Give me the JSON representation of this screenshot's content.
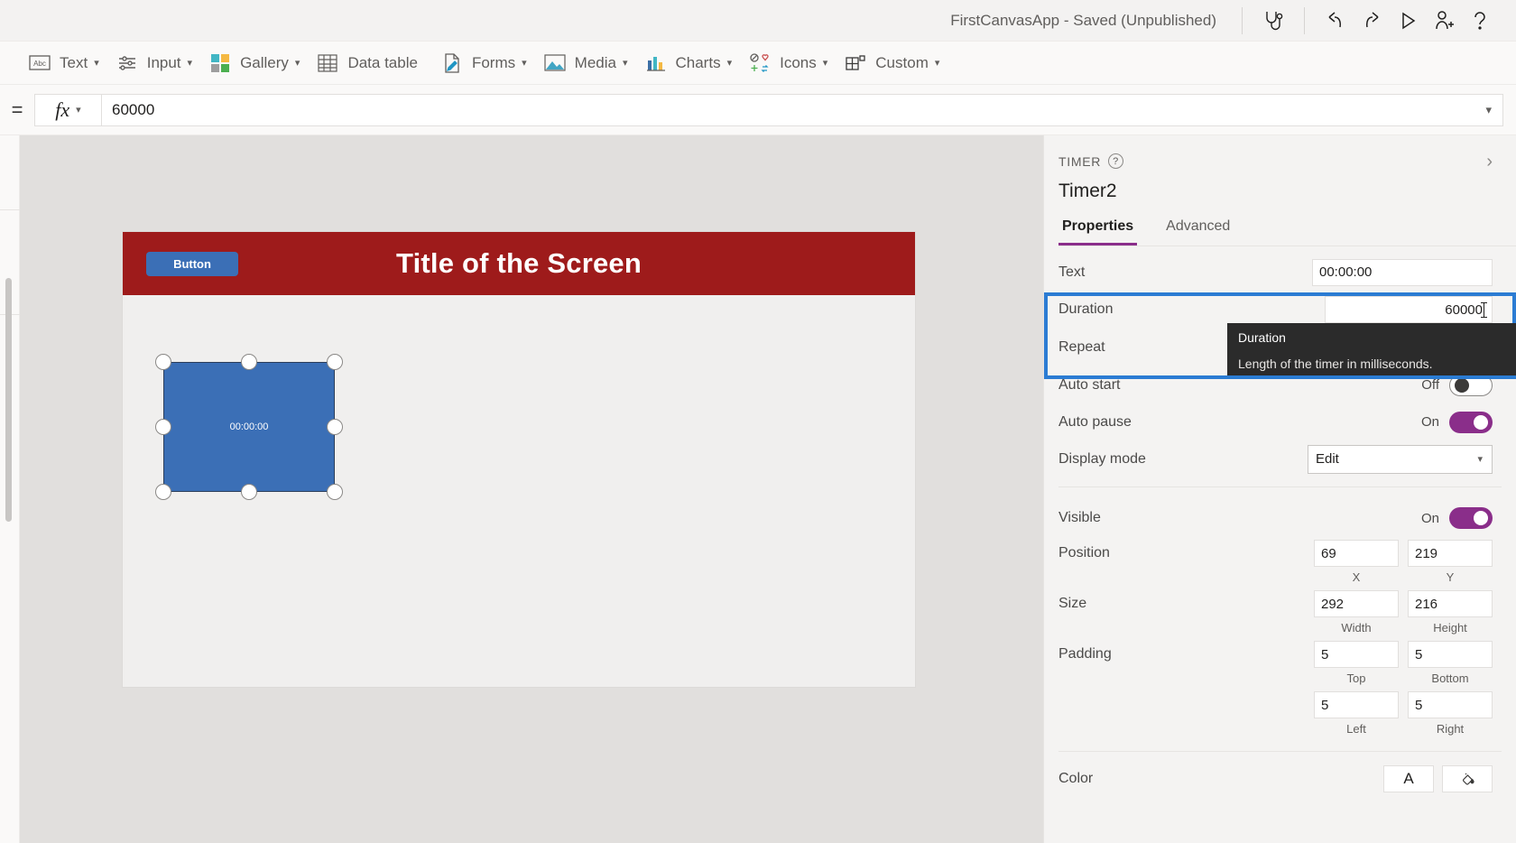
{
  "topbar": {
    "app_title": "FirstCanvasApp - Saved (Unpublished)",
    "icons": [
      {
        "name": "app-checker-icon",
        "glyph": "stethoscope"
      },
      {
        "name": "undo-icon",
        "glyph": "undo"
      },
      {
        "name": "redo-icon",
        "glyph": "redo"
      },
      {
        "name": "preview-play-icon",
        "glyph": "play"
      },
      {
        "name": "share-user-icon",
        "glyph": "person-add"
      },
      {
        "name": "help-icon",
        "glyph": "question"
      }
    ]
  },
  "ribbon": {
    "items": [
      {
        "label": "Text",
        "icon": "text-abc-icon",
        "has_caret": true
      },
      {
        "label": "Input",
        "icon": "input-sliders-icon",
        "has_caret": true
      },
      {
        "label": "Gallery",
        "icon": "gallery-grid-icon",
        "has_caret": true
      },
      {
        "label": "Data table",
        "icon": "data-table-icon",
        "has_caret": false
      },
      {
        "label": "Forms",
        "icon": "forms-document-icon",
        "has_caret": true
      },
      {
        "label": "Media",
        "icon": "media-image-icon",
        "has_caret": true
      },
      {
        "label": "Charts",
        "icon": "charts-bar-icon",
        "has_caret": true
      },
      {
        "label": "Icons",
        "icon": "icons-shapes-icon",
        "has_caret": true
      },
      {
        "label": "Custom",
        "icon": "custom-blocks-icon",
        "has_caret": true
      }
    ]
  },
  "formula_bar": {
    "equals": "=",
    "fx": "fx",
    "value": "60000"
  },
  "canvas": {
    "screen_header_title": "Title of the Screen",
    "header_button_label": "Button",
    "timer_control_text": "00:00:00"
  },
  "properties": {
    "kicker": "TIMER",
    "control_name": "Timer2",
    "tabs": [
      {
        "label": "Properties",
        "active": true
      },
      {
        "label": "Advanced",
        "active": false
      }
    ],
    "rows": {
      "text": {
        "label": "Text",
        "value": "00:00:00"
      },
      "duration": {
        "label": "Duration",
        "value": "60000"
      },
      "repeat": {
        "label": "Repeat",
        "value": ""
      },
      "auto_start": {
        "label": "Auto start",
        "state": "Off"
      },
      "auto_pause": {
        "label": "Auto pause",
        "state": "On"
      },
      "display_mode": {
        "label": "Display mode",
        "value": "Edit"
      },
      "visible": {
        "label": "Visible",
        "state": "On"
      },
      "position": {
        "label": "Position",
        "x": {
          "value": "69",
          "caption": "X"
        },
        "y": {
          "value": "219",
          "caption": "Y"
        }
      },
      "size": {
        "label": "Size",
        "width": {
          "value": "292",
          "caption": "Width"
        },
        "height": {
          "value": "216",
          "caption": "Height"
        }
      },
      "padding": {
        "label": "Padding",
        "top": {
          "value": "5",
          "caption": "Top"
        },
        "bottom": {
          "value": "5",
          "caption": "Bottom"
        },
        "left": {
          "value": "5",
          "caption": "Left"
        },
        "right": {
          "value": "5",
          "caption": "Right"
        }
      },
      "color": {
        "label": "Color",
        "text_btn": "A",
        "fill_btn": "fill-bucket-icon"
      }
    }
  },
  "tooltip": {
    "title": "Duration",
    "body": "Length of the timer in milliseconds."
  },
  "colors": {
    "accent_purple": "#8a2e8a",
    "header_red": "#9e1b1b",
    "control_blue": "#3b6fb6",
    "highlight_blue": "#2b7cd3",
    "tooltip_bg": "#2b2b2b"
  }
}
